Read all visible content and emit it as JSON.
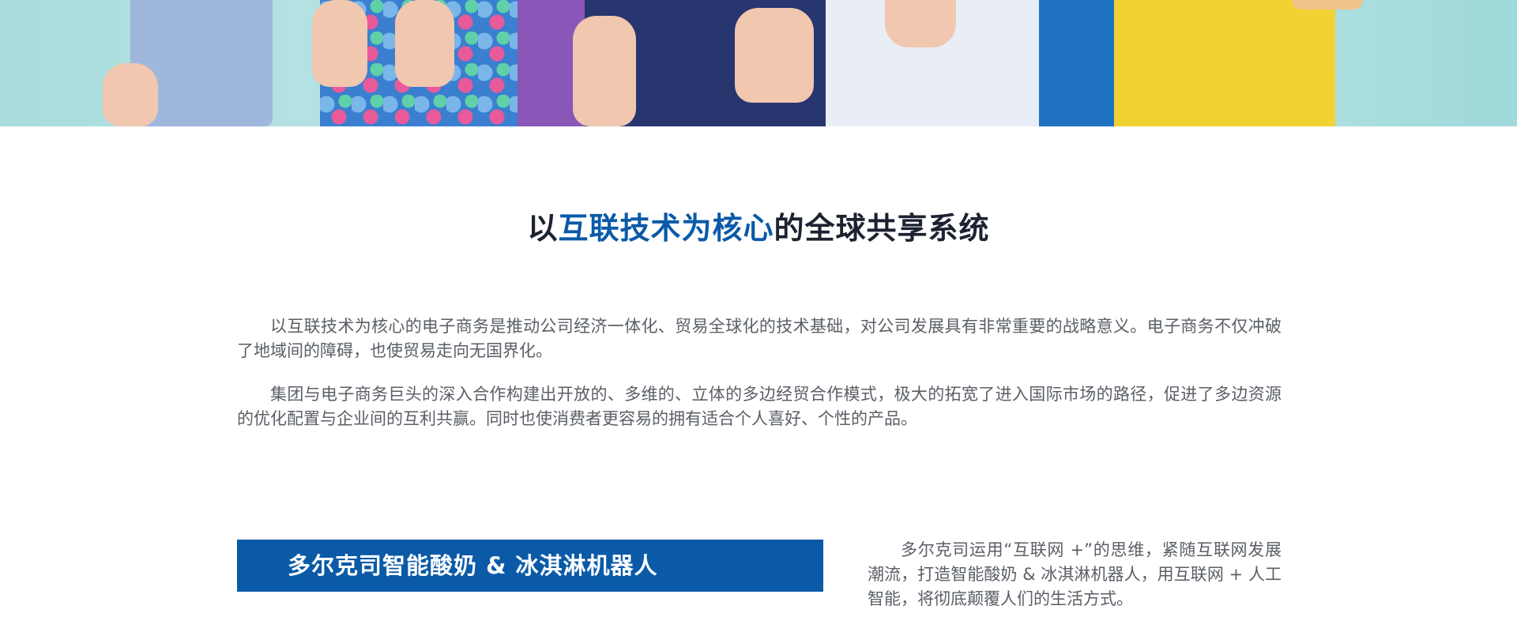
{
  "hero": {
    "image": "kids-thumbs-up-photo"
  },
  "heading": {
    "prefix": "以",
    "highlight": "互联技术为核心",
    "suffix": "的全球共享系统",
    "accent_color": "#0a5aa8"
  },
  "paragraphs": [
    "以互联技术为核心的电子商务是推动公司经济一体化、贸易全球化的技术基础，对公司发展具有非常重要的战略意义。电子商务不仅冲破了地域间的障碍，也使贸易走向无国界化。",
    "集团与电子商务巨头的深入合作构建出开放的、多维的、立体的多边经贸合作模式，极大的拓宽了进入国际市场的路径，促进了多边资源的优化配置与企业间的互利共赢。同时也使消费者更容易的拥有适合个人喜好、个性的产品。"
  ],
  "banner": {
    "title": "多尔克司智能酸奶 & 冰淇淋机器人",
    "color": "#0a5aa8"
  },
  "description": "多尔克司运用“互联网 +”的思维，紧随互联网发展潮流，打造智能酸奶 & 冰淇淋机器人，用互联网 + 人工智能，将彻底颠覆人们的生活方式。"
}
